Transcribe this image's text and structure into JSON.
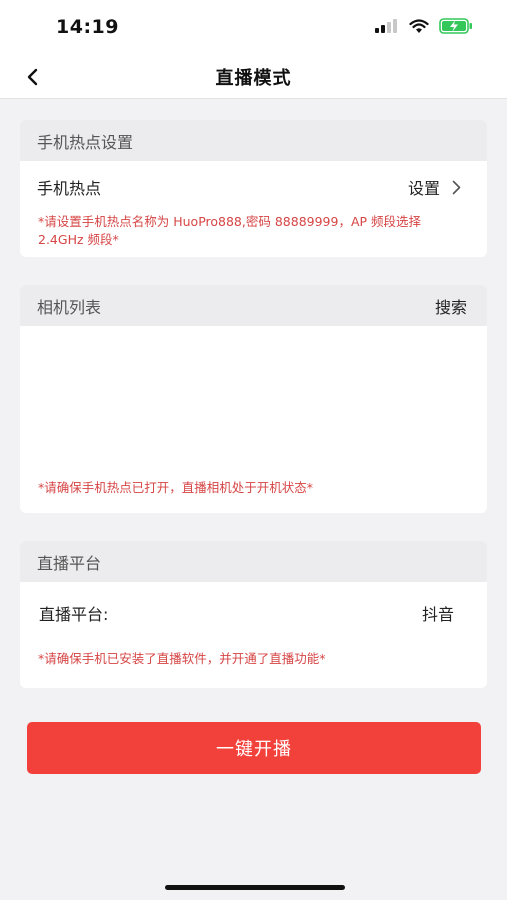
{
  "status_bar": {
    "time": "14:19"
  },
  "nav": {
    "title": "直播模式"
  },
  "hotspot_card": {
    "header": "手机热点设置",
    "row_label": "手机热点",
    "row_action": "设置",
    "note": "*请设置手机热点名称为 HuoPro888,密码 88889999，AP 频段选择 2.4GHz 频段*"
  },
  "camera_card": {
    "header": "相机列表",
    "header_action": "搜索",
    "note": "*请确保手机热点已打开，直播相机处于开机状态*"
  },
  "platform_card": {
    "header": "直播平台",
    "row_label": "直播平台:",
    "row_value": "抖音",
    "note": "*请确保手机已安装了直播软件，并开通了直播功能*"
  },
  "primary_button": {
    "label": "一键开播"
  },
  "colors": {
    "accent": "#f2403a",
    "note": "#d64545",
    "battery": "#34c759"
  },
  "icons": [
    "back-chevron-icon",
    "chevron-right-icon",
    "cellular-signal-icon",
    "wifi-icon",
    "battery-charging-icon"
  ]
}
